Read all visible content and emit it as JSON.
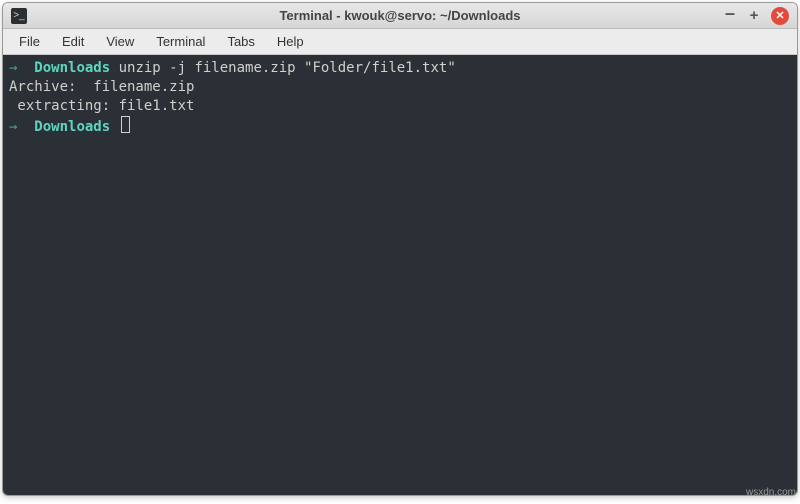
{
  "titlebar": {
    "title": "Terminal - kwouk@servo: ~/Downloads"
  },
  "menubar": {
    "file": "File",
    "edit": "Edit",
    "view": "View",
    "terminal": "Terminal",
    "tabs": "Tabs",
    "help": "Help"
  },
  "terminal": {
    "prompt_arrow": "→",
    "prompt_dir": "Downloads",
    "line1_cmd": "unzip -j filename.zip \"Folder/file1.txt\"",
    "line2": "Archive:  filename.zip",
    "line3": " extracting: file1.txt"
  },
  "watermark": "wsxdn.com"
}
